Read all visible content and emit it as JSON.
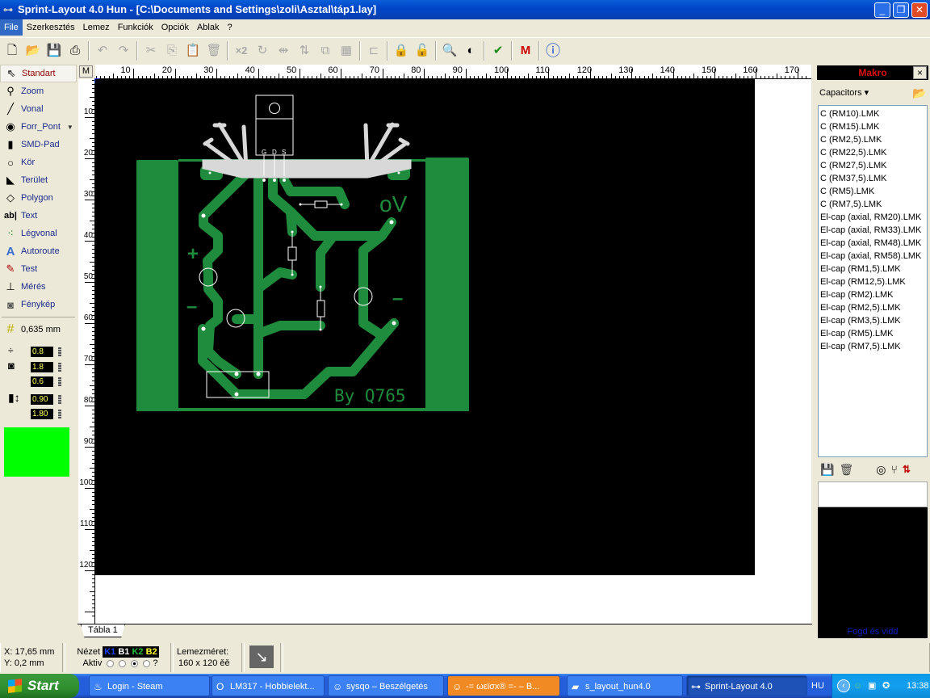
{
  "window": {
    "title": "Sprint-Layout 4.0 Hun - [C:\\Documents and Settings\\zoli\\Asztal\\táp1.lay]",
    "minimize": "_",
    "maximize": "❐",
    "close": "✕"
  },
  "menu": [
    "File",
    "Szerkesztés",
    "Lemez",
    "Funkciók",
    "Opciók",
    "Ablak",
    "?"
  ],
  "toolbar": {
    "icons": [
      "new-icon",
      "open-icon",
      "save-icon",
      "print-icon",
      "undo-icon",
      "redo-icon",
      "cut-icon",
      "copy-icon",
      "paste-icon",
      "delete-icon",
      "duplicate-icon",
      "rotate-icon",
      "mirror-h-icon",
      "mirror-v-icon",
      "group-icon",
      "fill-icon",
      "align-icon",
      "lock-icon",
      "unlock-icon",
      "zoom-icon",
      "contrast-icon",
      "drc-icon",
      "macro-icon",
      "info-icon"
    ],
    "x2_label": "×2"
  },
  "tools": [
    {
      "label": "Standart",
      "icon": "pointer-icon",
      "glyph": "⇖"
    },
    {
      "label": "Zoom",
      "icon": "zoom-icon",
      "glyph": "⚲"
    },
    {
      "label": "Vonal",
      "icon": "line-icon",
      "glyph": "╱"
    },
    {
      "label": "Forr_Pont",
      "icon": "pad-icon",
      "glyph": "◉"
    },
    {
      "label": "SMD-Pad",
      "icon": "smd-pad-icon",
      "glyph": "▮"
    },
    {
      "label": "Kör",
      "icon": "circle-icon",
      "glyph": "○"
    },
    {
      "label": "Terület",
      "icon": "area-icon",
      "glyph": "◣"
    },
    {
      "label": "Polygon",
      "icon": "polygon-icon",
      "glyph": "◇"
    },
    {
      "label": "Text",
      "icon": "text-icon",
      "glyph": "ab|"
    },
    {
      "label": "Légvonal",
      "icon": "airwire-icon",
      "glyph": "⁖"
    },
    {
      "label": "Autoroute",
      "icon": "autoroute-icon",
      "glyph": "A"
    },
    {
      "label": "Test",
      "icon": "test-probe-icon",
      "glyph": "✎"
    },
    {
      "label": "Mérés",
      "icon": "measure-icon",
      "glyph": "⊥"
    },
    {
      "label": "Fénykép",
      "icon": "camera-icon",
      "glyph": "◙"
    }
  ],
  "grid": {
    "value": "0,635 mm"
  },
  "params": {
    "track_width": "0.8",
    "pad_outer": "1.8",
    "pad_inner": "0.6",
    "smd_width": "0.90",
    "smd_height": "1.80"
  },
  "color_swatch": "#00ff00",
  "ruler": {
    "top": [
      "10",
      "20",
      "30",
      "40",
      "50",
      "60",
      "70",
      "80",
      "90",
      "100",
      "110",
      "120",
      "130",
      "140",
      "150",
      "160",
      "170"
    ],
    "left": [
      "10",
      "20",
      "30",
      "40",
      "50",
      "60",
      "70",
      "80",
      "90",
      "100",
      "110",
      "120"
    ],
    "m_button": "M"
  },
  "board": {
    "labels": {
      "ov": "oV",
      "plus": "+",
      "minus_left": "–",
      "minus_right": "–",
      "signature": "By Q765",
      "gate": "G",
      "drain": "D",
      "source": "S"
    },
    "copper_color": "#1e8c3c"
  },
  "tab": "Tábla 1",
  "macro": {
    "title": "Makro",
    "close": "×",
    "category": "Capacitors ▾",
    "items": [
      "C (RM10).LMK",
      "C (RM15).LMK",
      "C (RM2,5).LMK",
      "C (RM22,5).LMK",
      "C (RM27,5).LMK",
      "C (RM37,5).LMK",
      "C (RM5).LMK",
      "C (RM7,5).LMK",
      "El-cap (axial, RM20).LMK",
      "El-cap (axial, RM33).LMK",
      "El-cap (axial, RM48).LMK",
      "El-cap (axial, RM58).LMK",
      "El-cap (RM1,5).LMK",
      "El-cap (RM12,5).LMK",
      "El-cap (RM2).LMK",
      "El-cap (RM2,5).LMK",
      "El-cap (RM3,5).LMK",
      "El-cap (RM5).LMK",
      "El-cap (RM7,5).LMK"
    ],
    "drag_hint": "Fogd és vidd"
  },
  "status": {
    "x": "X: 17,65 mm",
    "y": "Y: 0,2 mm",
    "view_label": "Nézet",
    "layers": [
      {
        "name": "K1",
        "color": "#2040ff"
      },
      {
        "name": "B1",
        "color": "#ffffff"
      },
      {
        "name": "K2",
        "color": "#20c040"
      },
      {
        "name": "B2",
        "color": "#ffff30"
      }
    ],
    "active_label": "Aktiv",
    "active_index": 2,
    "help": "?",
    "board_size_label": "Lemezméret:",
    "board_size": "160 x 120 ěě"
  },
  "taskbar": {
    "start": "Start",
    "tasks": [
      {
        "label": "Login - Steam",
        "icon": "steam-icon",
        "glyph": "♨"
      },
      {
        "label": "LM317 - Hobbielekt...",
        "icon": "opera-icon",
        "glyph": "O"
      },
      {
        "label": "sysqo – Beszélgetés",
        "icon": "msn-icon",
        "glyph": "☺"
      },
      {
        "label": "-= ωεϊσx® =- – B...",
        "icon": "msn-icon",
        "glyph": "☺"
      },
      {
        "label": "s_layout_hun4.0",
        "icon": "folder-icon",
        "glyph": "▰"
      },
      {
        "label": "Sprint-Layout 4.0",
        "icon": "app-icon",
        "glyph": "⊶"
      }
    ],
    "lang": "HU",
    "clock": "13:38"
  }
}
